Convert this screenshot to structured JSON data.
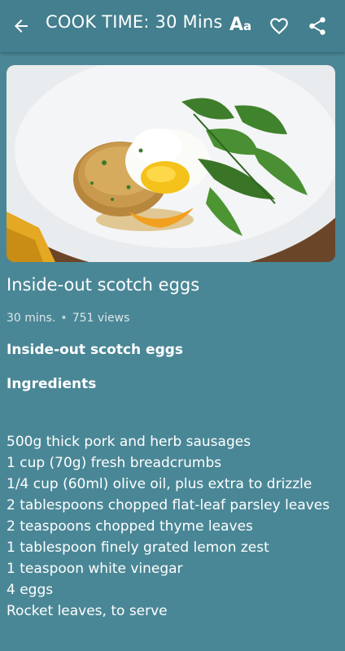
{
  "header": {
    "title": "COOK TIME: 30 Mins",
    "font_button_big": "A",
    "font_button_small": "a",
    "back_icon": "arrow-left-icon",
    "favorite_icon": "heart-outline-icon",
    "share_icon": "share-icon"
  },
  "recipe": {
    "title": "Inside-out scotch eggs",
    "duration": "30 mins.",
    "views": "751 views",
    "name_heading": "Inside-out scotch eggs",
    "ingredients_heading": "Ingredients",
    "ingredients": [
      " 500g thick pork and herb sausages",
      " 1 cup (70g) fresh breadcrumbs",
      " 1/4 cup (60ml) olive oil, plus extra to drizzle",
      " 2 tablespoons chopped flat-leaf parsley leaves",
      " 2 teaspoons chopped thyme leaves",
      " 1 tablespoon finely grated lemon zest",
      " 1 teaspoon white vinegar",
      " 4 eggs",
      " Rocket leaves, to serve"
    ]
  },
  "colors": {
    "background": "#4a8796",
    "toolbar": "#437f8e",
    "text": "#ffffff"
  }
}
